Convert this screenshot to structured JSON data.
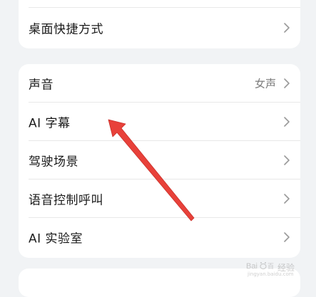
{
  "top_card": {
    "items": [
      {
        "label": "桌面快捷方式"
      }
    ]
  },
  "main_card": {
    "items": [
      {
        "label": "声音",
        "value": "女声"
      },
      {
        "label": "AI 字幕"
      },
      {
        "label": "驾驶场景"
      },
      {
        "label": "语音控制呼叫"
      },
      {
        "label": "AI 实验室"
      }
    ]
  },
  "annotation": {
    "arrow_color": "#e8413a"
  },
  "watermark": {
    "logo_text": "Bai百度",
    "text": "经验",
    "sub": "jingyan.baidu.com"
  }
}
